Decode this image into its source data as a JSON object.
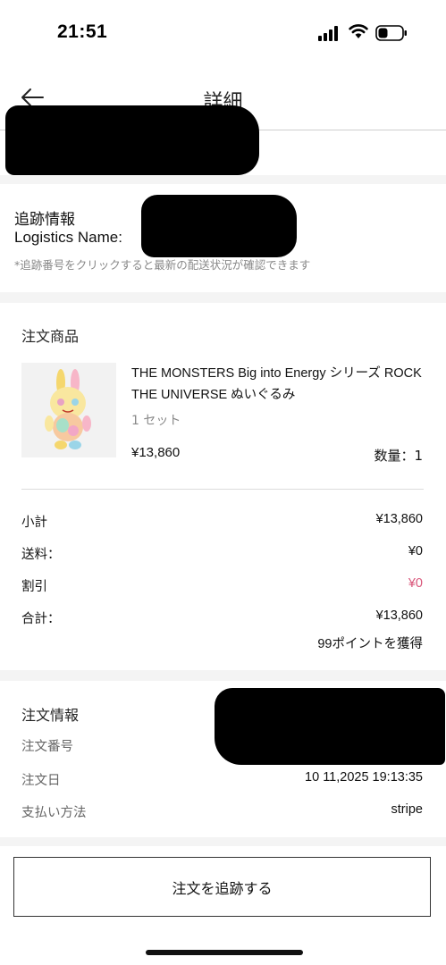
{
  "status_bar": {
    "time": "21:51"
  },
  "header": {
    "title": "詳細"
  },
  "tracking": {
    "title": "追跡情報",
    "logistics_label": "Logistics Name:",
    "note": "*追跡番号をクリックすると最新の配送状況が確認できます"
  },
  "products": {
    "title": "注文商品",
    "item": {
      "name": "THE MONSTERS Big into Energy シリーズ ROCK THE UNIVERSE ぬいぐるみ",
      "set": "1 セット",
      "price": "¥13,860",
      "qty": "数量：1"
    }
  },
  "summary": {
    "subtotal_label": "小計",
    "subtotal_value": "¥13,860",
    "shipping_label": "送料：",
    "shipping_value": "¥0",
    "discount_label": "割引",
    "discount_value": "¥0",
    "total_label": "合計：",
    "total_value": "¥13,860",
    "points": "99ポイントを獲得"
  },
  "order_info": {
    "title": "注文情報",
    "number_label": "注文番号",
    "date_label": "注文日",
    "date_value": "10 11,2025 19:13:35",
    "payment_label": "支払い方法",
    "payment_value": "stripe"
  },
  "actions": {
    "track_button": "注文を追跡する"
  },
  "colors": {
    "discount": "#d9567a",
    "section_gap": "#f4f4f4"
  }
}
